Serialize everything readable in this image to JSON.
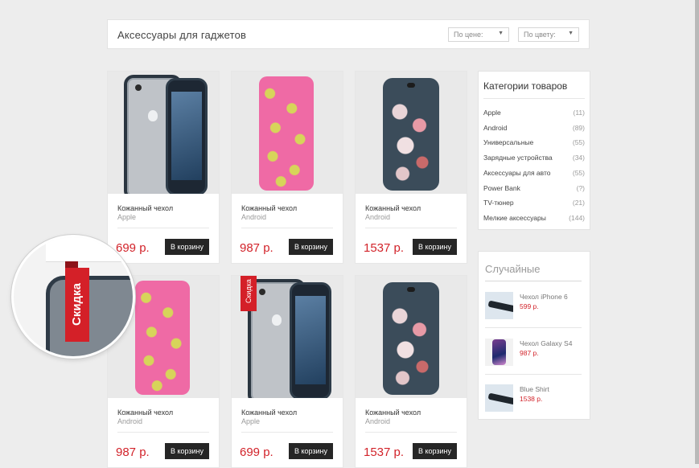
{
  "header": {
    "title": "Аксессуары для гаджетов",
    "sort_price": "По цене:",
    "sort_color": "По цвету:"
  },
  "products": [
    {
      "name": "Кожанный чехол",
      "brand": "Apple",
      "price": "699 р.",
      "button": "В корзину",
      "image": "iphone-bumper-case"
    },
    {
      "name": "Кожанный чехол",
      "brand": "Android",
      "price": "987 р.",
      "button": "В корзину",
      "image": "pineapple-case"
    },
    {
      "name": "Кожанный чехол",
      "brand": "Android",
      "price": "1537 р.",
      "button": "В корзину",
      "image": "floral-skull-case"
    },
    {
      "name": "Кожанный чехол",
      "brand": "Android",
      "price": "987 р.",
      "button": "В корзину",
      "image": "pineapple-case"
    },
    {
      "name": "Кожанный чехол",
      "brand": "Apple",
      "price": "699 р.",
      "button": "В корзину",
      "image": "iphone-bumper-case",
      "badge": "Скидка"
    },
    {
      "name": "Кожанный чехол",
      "brand": "Android",
      "price": "1537 р.",
      "button": "В корзину",
      "image": "floral-skull-case"
    }
  ],
  "categories": {
    "title": "Категории товаров",
    "items": [
      {
        "label": "Apple",
        "count": "(11)"
      },
      {
        "label": "Android",
        "count": "(89)"
      },
      {
        "label": "Универсальные",
        "count": "(55)"
      },
      {
        "label": "Зарядные устройства",
        "count": "(34)"
      },
      {
        "label": "Аксессуары для авто",
        "count": "(55)"
      },
      {
        "label": "Power Bank",
        "count": "(?)"
      },
      {
        "label": "TV-тюнер",
        "count": "(21)"
      },
      {
        "label": "Мелкие аксессуары",
        "count": "(144)"
      }
    ]
  },
  "random": {
    "title": "Случайные",
    "items": [
      {
        "name": "Чехол iPhone 6",
        "price": "599 р."
      },
      {
        "name": "Чехол Galaxy S4",
        "price": "987 р."
      },
      {
        "name": "Blue Shirt",
        "price": "1538 р."
      }
    ]
  },
  "magnifier": {
    "badge": "Скидка"
  },
  "colors": {
    "accent": "#d2232a",
    "button": "#262626",
    "background": "#ededed"
  }
}
